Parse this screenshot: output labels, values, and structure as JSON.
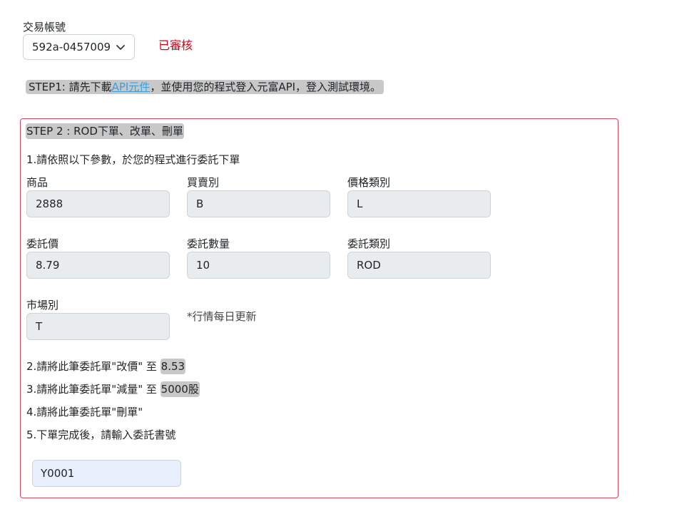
{
  "account": {
    "label": "交易帳號",
    "selected": "592a-0457009",
    "status": "已審核"
  },
  "step1": {
    "prefix": "STEP1: 請先下載",
    "link": "API元件",
    "suffix": "，並使用您的程式登入元富API，登入測試環境。"
  },
  "step2": {
    "title": "STEP 2 : ROD下單、改單、刪單",
    "instruction1": "1.請依照以下參數，於您的程式進行委託下單",
    "fields": {
      "product": {
        "label": "商品",
        "value": "2888"
      },
      "side": {
        "label": "買賣別",
        "value": "B"
      },
      "price_type": {
        "label": "價格類別",
        "value": "L"
      },
      "price": {
        "label": "委託價",
        "value": "8.79"
      },
      "quantity": {
        "label": "委託數量",
        "value": "10"
      },
      "order_type": {
        "label": "委託類別",
        "value": "ROD"
      },
      "market": {
        "label": "市場別",
        "value": "T"
      }
    },
    "market_note": "*行情每日更新",
    "instruction2_prefix": "2.請將此筆委託單\"改價\" 至 ",
    "instruction2_value": "8.53",
    "instruction3_prefix": "3.請將此筆委託單\"減量\" 至 ",
    "instruction3_value": "5000股",
    "instruction4": "4.請將此筆委託單\"刪單\"",
    "instruction5": "5.下單完成後，請輸入委託書號",
    "order_no_value": "Y0001"
  }
}
